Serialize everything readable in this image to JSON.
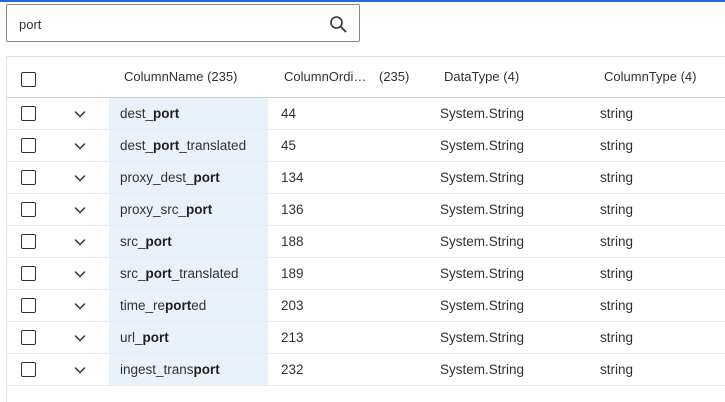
{
  "search": {
    "value": "port"
  },
  "table": {
    "headers": {
      "column_name": "ColumnName (235)",
      "column_ordinal": "ColumnOrdi…",
      "column_ordinal_count": "(235)",
      "data_type": "DataType (4)",
      "column_type": "ColumnType (4)"
    },
    "rows": [
      {
        "name": [
          "dest_",
          "port",
          ""
        ],
        "ordinal": "44",
        "data_type": "System.String",
        "column_type": "string"
      },
      {
        "name": [
          "dest_",
          "port",
          "_translated"
        ],
        "ordinal": "45",
        "data_type": "System.String",
        "column_type": "string"
      },
      {
        "name": [
          "proxy_dest_",
          "port",
          ""
        ],
        "ordinal": "134",
        "data_type": "System.String",
        "column_type": "string"
      },
      {
        "name": [
          "proxy_src_",
          "port",
          ""
        ],
        "ordinal": "136",
        "data_type": "System.String",
        "column_type": "string"
      },
      {
        "name": [
          "src_",
          "port",
          ""
        ],
        "ordinal": "188",
        "data_type": "System.String",
        "column_type": "string"
      },
      {
        "name": [
          "src_",
          "port",
          "_translated"
        ],
        "ordinal": "189",
        "data_type": "System.String",
        "column_type": "string"
      },
      {
        "name": [
          "time_re",
          "port",
          "ed"
        ],
        "ordinal": "203",
        "data_type": "System.String",
        "column_type": "string"
      },
      {
        "name": [
          "url_",
          "port",
          ""
        ],
        "ordinal": "213",
        "data_type": "System.String",
        "column_type": "string"
      },
      {
        "name": [
          "ingest_trans",
          "port",
          ""
        ],
        "ordinal": "232",
        "data_type": "System.String",
        "column_type": "string"
      }
    ]
  },
  "colors": {
    "accent": "#1a6fd6",
    "highlight": "#e9f1fa"
  },
  "icons": {
    "search": "search-icon",
    "expand": "chevron-down-icon"
  }
}
